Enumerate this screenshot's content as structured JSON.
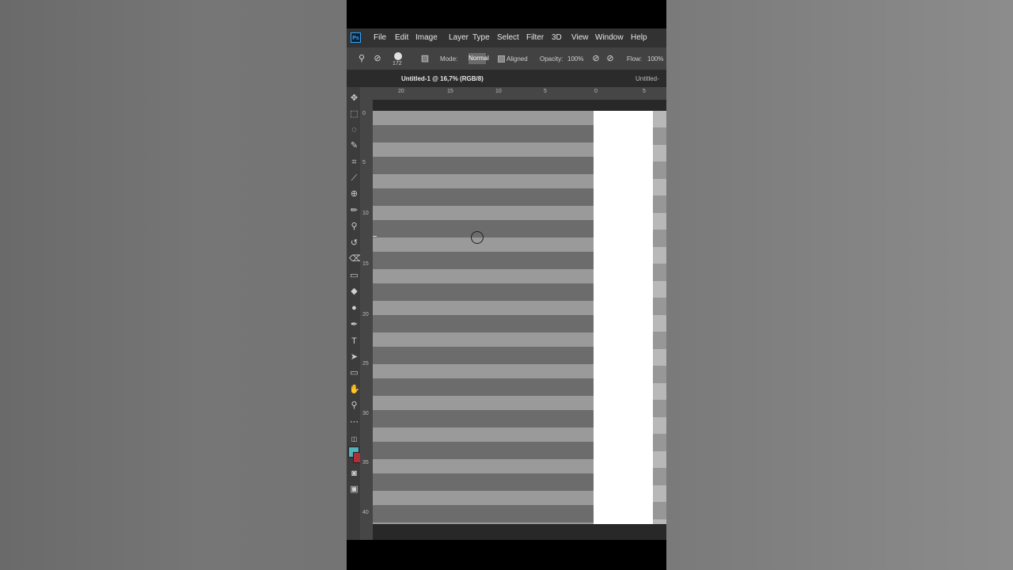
{
  "app": {
    "logo": "Ps"
  },
  "menu": [
    "File",
    "Edit",
    "Image",
    "Layer",
    "Type",
    "Select",
    "Filter",
    "3D",
    "View",
    "Window",
    "Help"
  ],
  "options": {
    "brush_size": "172",
    "mode_label": "Mode:",
    "mode_value": "Normal",
    "aligned_label": "Aligned",
    "opacity_label": "Opacity:",
    "opacity_value": "100%",
    "flow_label": "Flow:",
    "flow_value": "100%"
  },
  "tabs": [
    {
      "label": "Untitled-1 @ 16,7% (RGB/8)",
      "active": true
    },
    {
      "label": "Untitled-",
      "active": false
    }
  ],
  "ruler_top": [
    "20",
    "15",
    "10",
    "5",
    "0",
    "5"
  ],
  "ruler_left": [
    "0",
    "5",
    "10",
    "15",
    "20",
    "25",
    "30",
    "35",
    "40"
  ],
  "colors": {
    "foreground": "#4fb3b8",
    "background": "#b0303a",
    "stripe_light": "#9a9a9a",
    "stripe_dark": "#6c6c6c"
  },
  "icons": {
    "tools": [
      "move-icon",
      "marquee-icon",
      "lasso-icon",
      "quick-select-icon",
      "crop-icon",
      "eyedropper-icon",
      "healing-brush-icon",
      "brush-icon",
      "clone-stamp-icon",
      "history-brush-icon",
      "eraser-icon",
      "gradient-icon",
      "blur-icon",
      "dodge-icon",
      "pen-icon",
      "type-icon",
      "path-select-icon",
      "rectangle-icon",
      "hand-icon",
      "zoom-icon",
      "more-tools-icon",
      "quick-mask-icon",
      "screen-mode-icon"
    ]
  }
}
